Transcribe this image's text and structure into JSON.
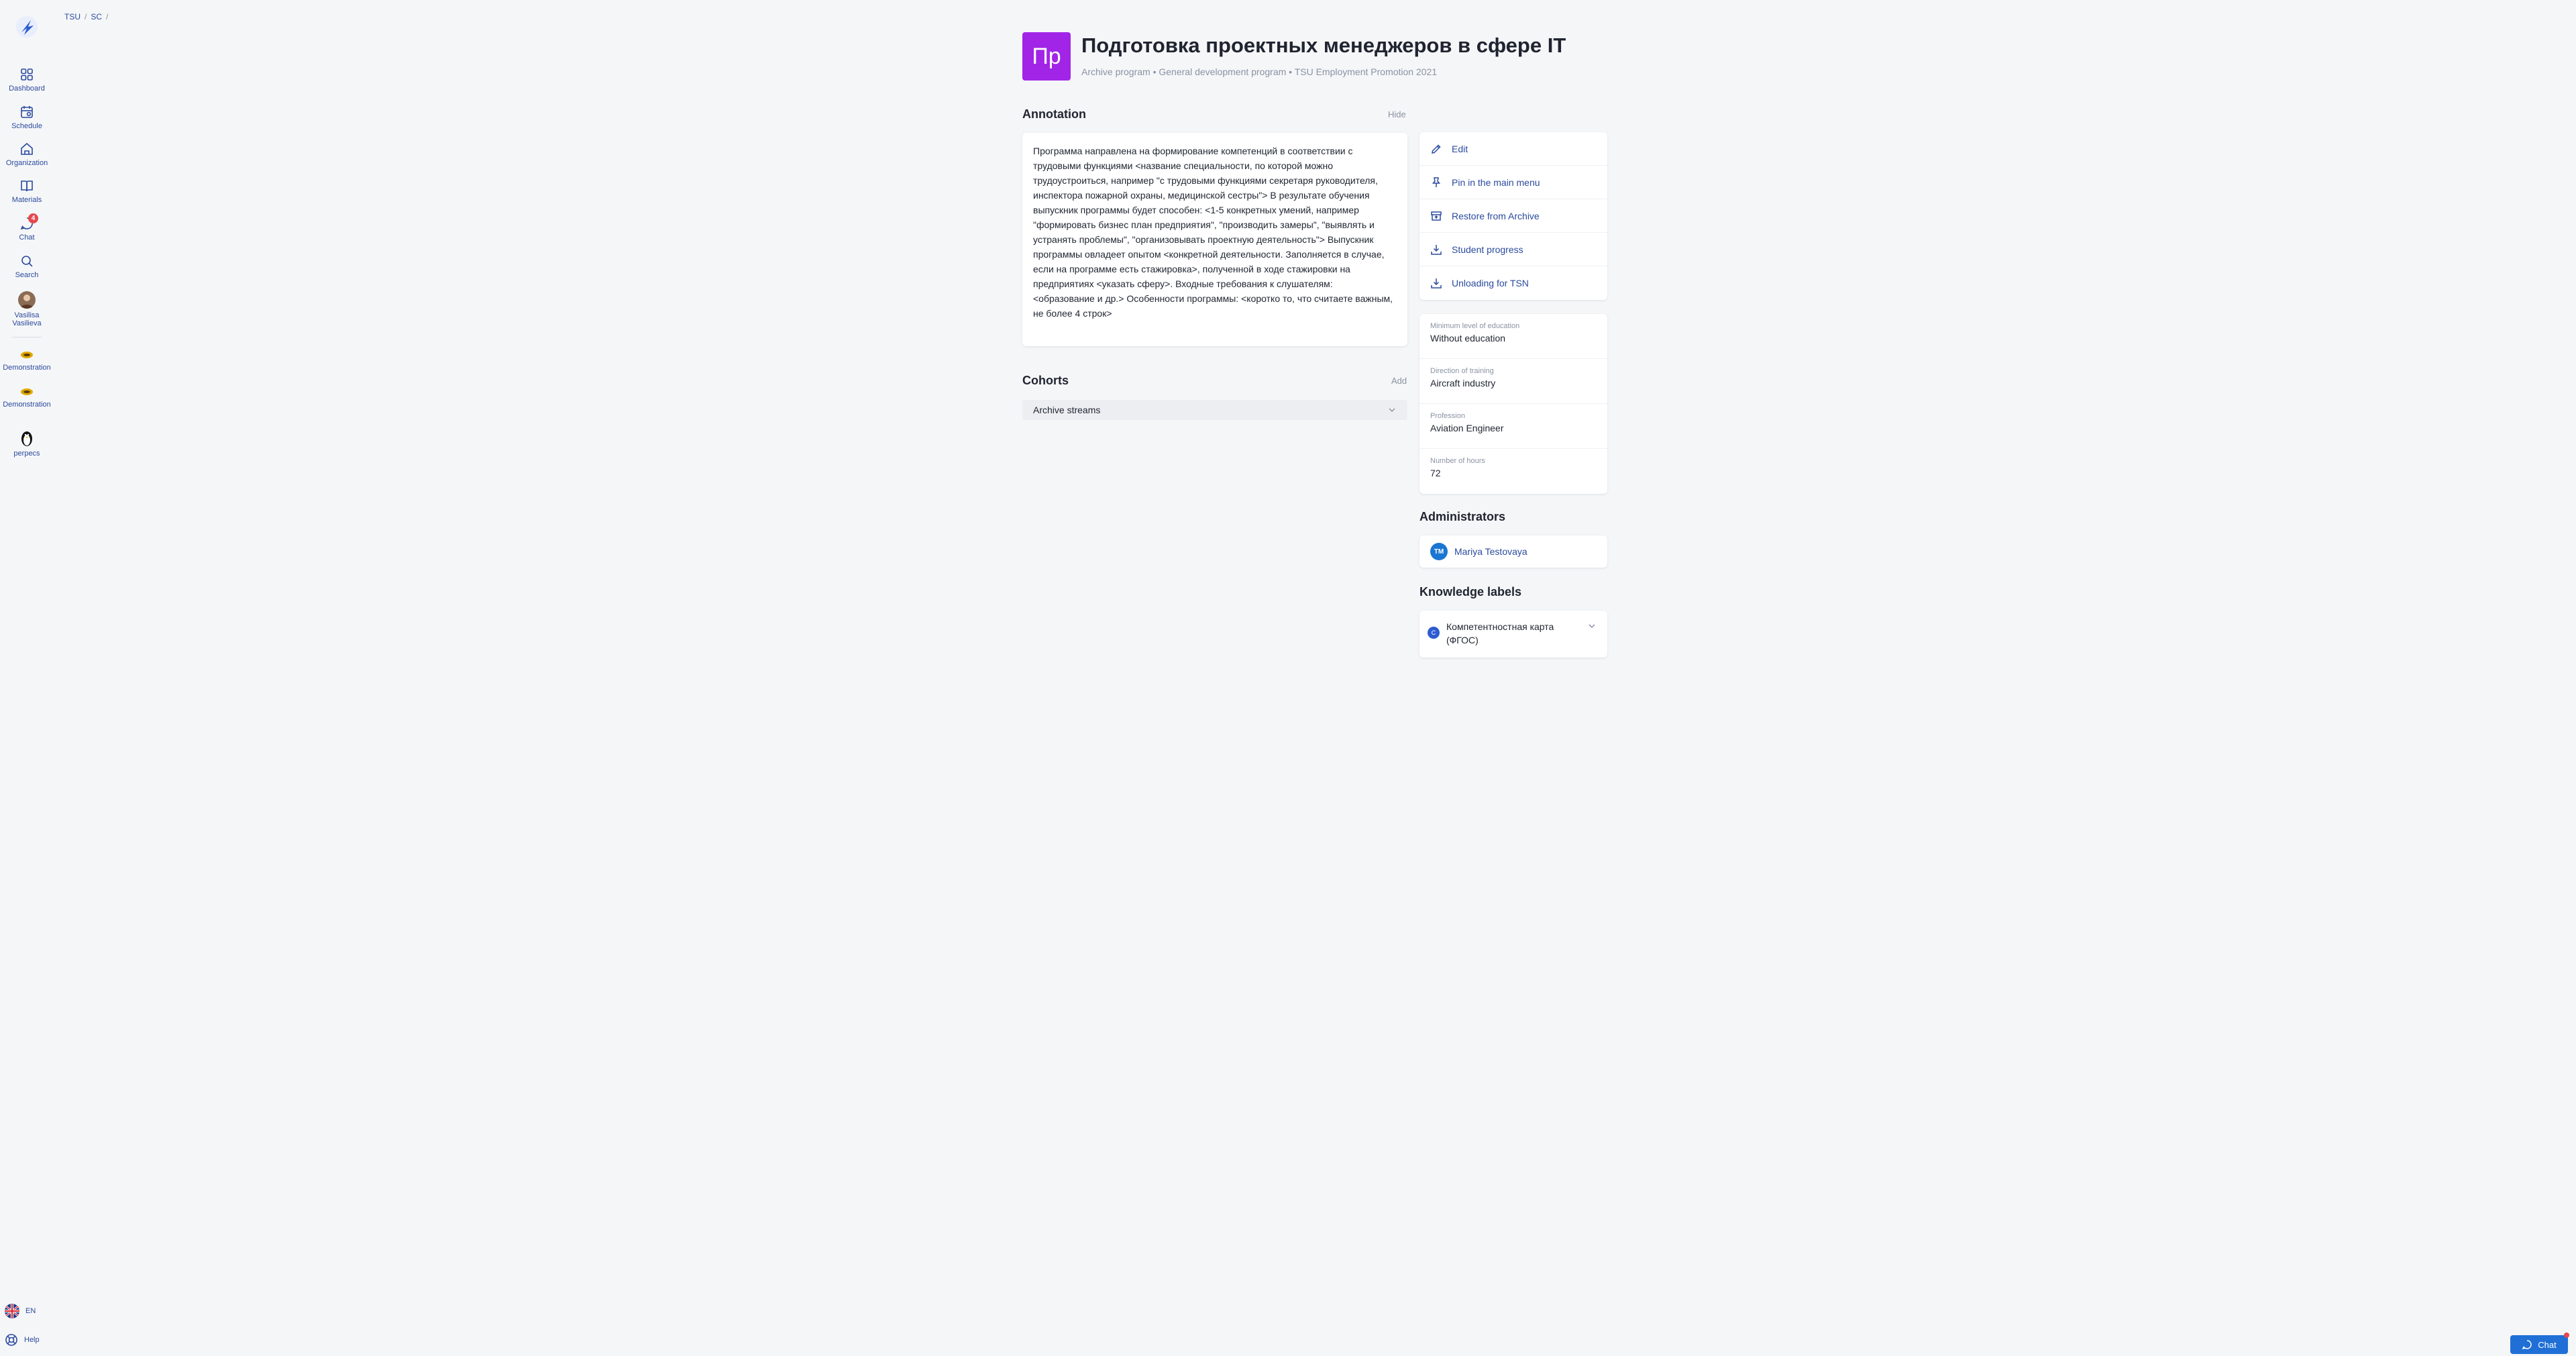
{
  "sidebar": {
    "items": [
      {
        "label": "Dashboard",
        "icon": "dashboard-icon"
      },
      {
        "label": "Schedule",
        "icon": "calendar-icon"
      },
      {
        "label": "Organization",
        "icon": "home-icon"
      },
      {
        "label": "Materials",
        "icon": "book-icon"
      },
      {
        "label": "Chat",
        "icon": "chat-icon",
        "badge": "4"
      },
      {
        "label": "Search",
        "icon": "search-icon"
      }
    ],
    "user": {
      "name_line1": "Vasilisa",
      "name_line2": "Vasilieva"
    },
    "orgs": [
      {
        "label": "Demonstration"
      },
      {
        "label": "Demonstration"
      },
      {
        "label": "perpecs"
      }
    ],
    "language": "EN",
    "help": "Help"
  },
  "breadcrumb": {
    "items": [
      "TSU",
      "SC"
    ],
    "separator": "/"
  },
  "header": {
    "icon_text": "Пр",
    "title": "Подготовка проектных менеджеров в сфере IT",
    "subtitle": "Archive program • General development program • TSU Employment Promotion 2021",
    "icon_color": "#a224e6"
  },
  "annotation": {
    "heading": "Annotation",
    "hide_label": "Hide",
    "text": "Программа направлена на формирование компетенций в соответствии с трудовыми функциями <название специальности, по которой можно трудоустроиться, например \"с трудовыми функциями секретаря руководителя, инспектора пожарной охраны, медицинской сестры\"> В результате обучения выпускник программы будет способен: <1-5 конкретных умений, например \"формировать бизнес план предприятия\", \"производить замеры\", \"выявлять и устранять проблемы\", \"организовывать проектную деятельность\"> Выпускник программы овладеет опытом <конкретной деятельности. Заполняется в случае, если на программе есть стажировка>, полученной в ходе стажировки на предприятиях <указать сферу>. Входные требования к слушателям: <образование и др.> Особенности программы: <коротко то, что считаете важным, не более 4 строк>"
  },
  "cohorts": {
    "heading": "Cohorts",
    "add_label": "Add",
    "row_label": "Archive streams"
  },
  "actions": [
    {
      "label": "Edit",
      "icon": "pencil-icon"
    },
    {
      "label": "Pin in the main menu",
      "icon": "pin-icon"
    },
    {
      "label": "Restore from Archive",
      "icon": "archive-restore-icon"
    },
    {
      "label": "Student progress",
      "icon": "download-icon"
    },
    {
      "label": "Unloading for TSN",
      "icon": "download-icon"
    }
  ],
  "info": [
    {
      "label": "Minimum level of education",
      "value": "Without education"
    },
    {
      "label": "Direction of training",
      "value": "Aircraft industry"
    },
    {
      "label": "Profession",
      "value": "Aviation Engineer"
    },
    {
      "label": "Number of hours",
      "value": "72"
    }
  ],
  "administrators": {
    "heading": "Administrators",
    "people": [
      {
        "initials": "TM",
        "name": "Mariya Testovaya"
      }
    ]
  },
  "knowledge_labels": {
    "heading": "Knowledge labels",
    "items": [
      {
        "dot": "C",
        "line1": "Компетентностная карта",
        "line2": "(ФГОС)"
      }
    ]
  },
  "chat_button": {
    "label": "Chat"
  },
  "colors": {
    "accent": "#2a4a9c",
    "brand": "#1f6fd6",
    "badge": "#e5484d"
  }
}
